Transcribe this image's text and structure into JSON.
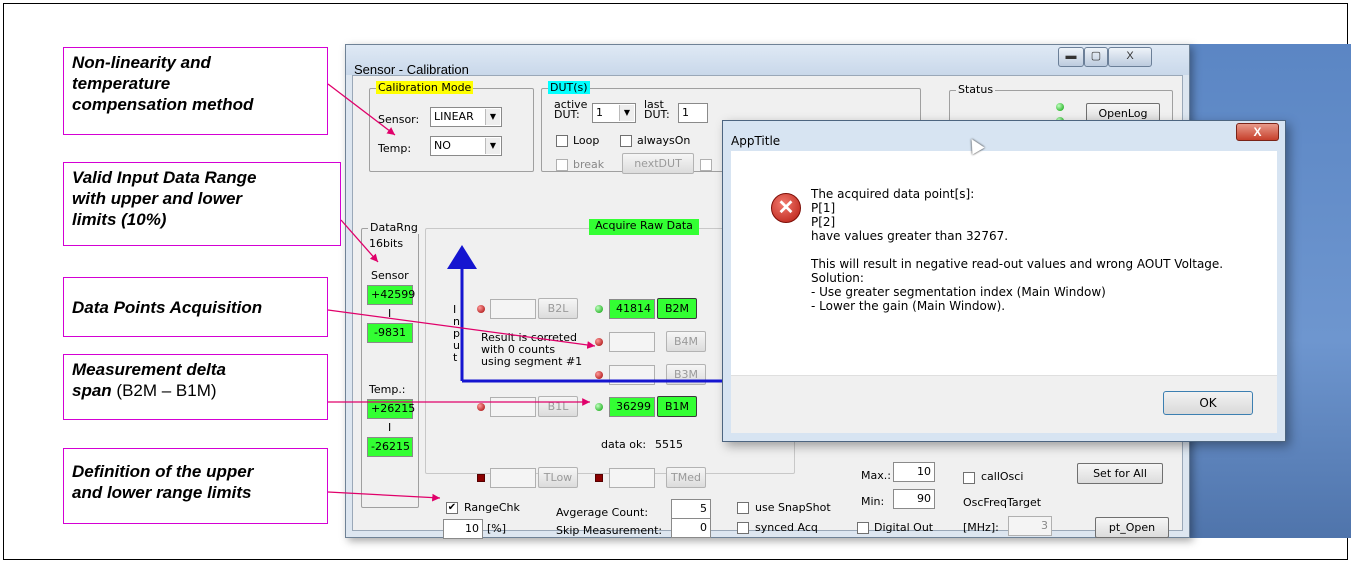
{
  "callouts": {
    "method_line1": "Non-linearity and",
    "method_line2": "temperature",
    "method_line3": "compensation method",
    "range_line1": "Valid Input Data Range",
    "range_line2": "with upper and lower",
    "range_line3": "limits (10%)",
    "acq": "Data Points Acquisition",
    "delta_line1": "Measurement delta",
    "delta_bold": "span",
    "delta_plain": " (B2M – B1M)",
    "limits_line1": "Definition of the upper",
    "limits_line2": "and lower range limits"
  },
  "window": {
    "title": "Sensor - Calibration",
    "min": "▬",
    "max": "▢",
    "close": "X"
  },
  "calibration_mode": {
    "label": "Calibration Mode",
    "sensor_label": "Sensor:",
    "sensor_value": "LINEAR",
    "temp_label": "Temp:",
    "temp_value": "NO"
  },
  "dut": {
    "label": "DUT(s)",
    "active_label1": "active",
    "active_label2": "DUT:",
    "active_value": "1",
    "last_label1": "last",
    "last_label2": "DUT:",
    "last_value": "1",
    "loop_label": "Loop",
    "always_on_label": "alwaysOn",
    "break_label": "break",
    "next_dut_label": "nextDUT"
  },
  "status": {
    "label": "Status",
    "open_log": "OpenLog"
  },
  "data_range": {
    "label": "DataRng",
    "bits": "16bits",
    "sensor_label": "Sensor",
    "sensor_upper": "+42599",
    "separator": "I",
    "sensor_lower": "-9831",
    "temp_label": "Temp.:",
    "temp_upper": "+26215",
    "temp_lower": "-26215"
  },
  "acquire": {
    "header": "Acquire Raw Data",
    "input_label": [
      "I",
      "n",
      "p",
      "u",
      "t"
    ],
    "b2l": "B2L",
    "b2m": "B2M",
    "b2m_value": "41814",
    "b4m": "B4M",
    "b3m": "B3M",
    "b1l": "B1L",
    "b1m": "B1M",
    "b1m_value": "36299",
    "result_line1": "Result is correted",
    "result_line2": "with 0 counts",
    "result_line3": "using segment #1",
    "data_ok_label": "data ok:",
    "data_ok_value": "5515",
    "tlow": "TLow",
    "tmed": "TMed"
  },
  "bottom": {
    "range_chk_label": "RangeChk",
    "range_value": "10",
    "range_unit": "[%]",
    "avg_count_label": "Avgerage Count:",
    "avg_count_value": "5",
    "skip_label": "Skip Measurement:",
    "skip_value": "0",
    "use_snapshot_label": "use SnapShot",
    "synced_acq_label": "synced Acq",
    "max_label": "Max.:",
    "max_value": "10",
    "min_label": "Min:",
    "min_value": "90",
    "digital_out_label": "Digital Out",
    "call_osci_label": "callOsci",
    "osc_freq_label": "OscFreqTarget",
    "mhz_label": "[MHz]:",
    "mhz_value": "3",
    "set_for_all": "Set for All",
    "pt_open": "pt_Open"
  },
  "dialog": {
    "title": "AppTitle",
    "close": "X",
    "message": "The acquired data point[s]:\nP[1]\nP[2]\nhave values greater than 32767.\n\nThis will result in negative read-out values and wrong AOUT Voltage.\nSolution:\n- Use greater segmentation index (Main Window)\n- Lower the gain (Main Window).",
    "ok": "OK"
  }
}
